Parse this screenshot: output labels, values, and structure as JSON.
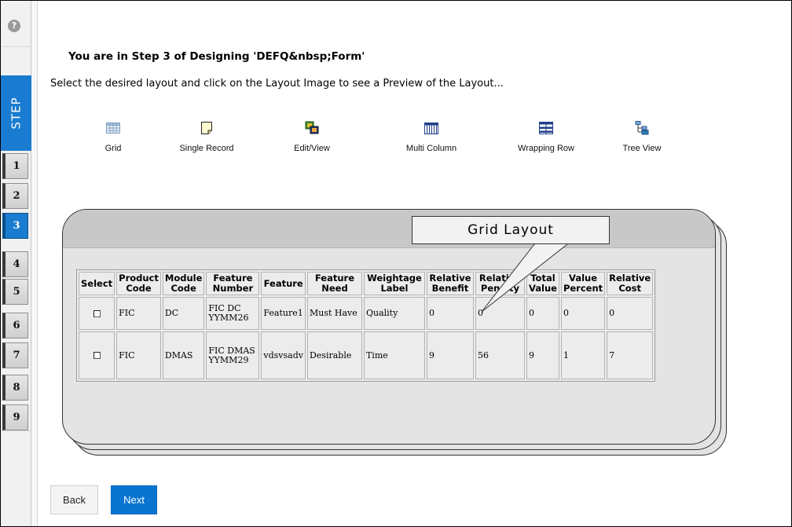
{
  "header": {
    "title": "You are in Step 3 of Designing 'DEFQ&nbsp;Form'",
    "instruction": "Select the desired layout and click on the Layout Image to see a Preview of the Layout..."
  },
  "rail": {
    "help_icon": "question-icon",
    "help_glyph": "?",
    "step_label": "STEP",
    "steps": [
      "1",
      "2",
      "3",
      "4",
      "5",
      "6",
      "7",
      "8",
      "9"
    ],
    "active_step": "3"
  },
  "layouts": [
    {
      "label": "Grid",
      "icon": "grid-icon"
    },
    {
      "label": "Single Record",
      "icon": "single-record-icon"
    },
    {
      "label": "Edit/View",
      "icon": "edit-view-icon"
    },
    {
      "label": "Multi Column",
      "icon": "multi-column-icon"
    },
    {
      "label": "Wrapping Row",
      "icon": "wrapping-row-icon"
    },
    {
      "label": "Tree View",
      "icon": "tree-view-icon"
    }
  ],
  "preview": {
    "callout": "Grid Layout",
    "columns": [
      "Select",
      "Product Code",
      "Module Code",
      "Feature Number",
      "Feature",
      "Feature Need",
      "Weightage Label",
      "Relative Benefit",
      "Relative Penalty",
      "Total Value",
      "Value Percent",
      "Relative Cost"
    ],
    "rows": [
      [
        "",
        "FIC",
        "DC",
        "FIC DC YYMM26",
        "Feature1",
        "Must Have",
        "Quality",
        "0",
        "0",
        "0",
        "0",
        "0"
      ],
      [
        "",
        "FIC",
        "DMAS",
        "FIC DMAS YYMM29",
        "vdsvsadv",
        "Desirable",
        "Time",
        "9",
        "56",
        "9",
        "1",
        "7"
      ]
    ]
  },
  "buttons": {
    "back": "Back",
    "next": "Next"
  },
  "colors": {
    "accent": "#1a7cd0",
    "next_button": "#0a74d1"
  }
}
